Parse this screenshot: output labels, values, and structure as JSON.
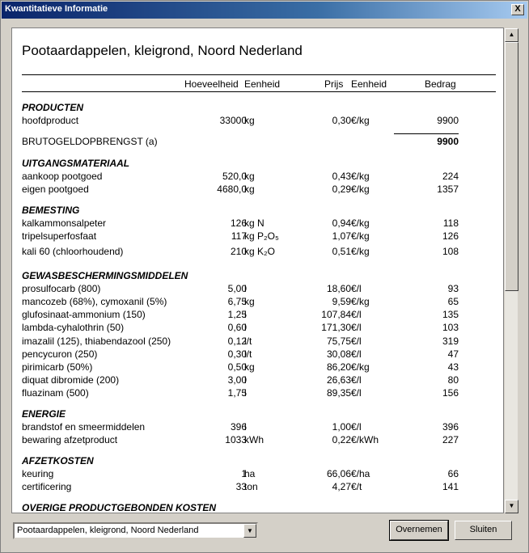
{
  "window": {
    "title": "Kwantitatieve Informatie",
    "close_glyph": "X"
  },
  "report": {
    "title": "Pootaardappelen, kleigrond, Noord Nederland",
    "headers": {
      "qty": "Hoeveelheid",
      "unit": "Eenheid",
      "price": "Prijs",
      "punit": "Eenheid",
      "amount": "Bedrag"
    },
    "sections": {
      "producten": "PRODUCTEN",
      "uitgangsmateriaal": "UITGANGSMATERIAAL",
      "bemesting": "BEMESTING",
      "gewas": "GEWASBESCHERMINGSMIDDELEN",
      "energie": "ENERGIE",
      "afzet": "AFZETKOSTEN",
      "overige": "OVERIGE PRODUCTGEBONDEN KOSTEN"
    },
    "rows": {
      "hoofdproduct": {
        "name": "hoofdproduct",
        "qty": "33000",
        "unit": "kg",
        "price": "0,30",
        "punit": "€/kg",
        "amount": "9900"
      },
      "bruto": {
        "name": "BRUTOGELDOPBRENGST (a)",
        "amount": "9900"
      },
      "aankoop": {
        "name": "aankoop pootgoed",
        "qty": "520,0",
        "unit": "kg",
        "price": "0,43",
        "punit": "€/kg",
        "amount": "224"
      },
      "eigen": {
        "name": "eigen pootgoed",
        "qty": "4680,0",
        "unit": "kg",
        "price": "0,29",
        "punit": "€/kg",
        "amount": "1357"
      },
      "kalkammon": {
        "name": "kalkammonsalpeter",
        "qty": "126",
        "unit": "kg N",
        "price": "0,94",
        "punit": "€/kg",
        "amount": "118"
      },
      "tripel": {
        "name": "tripelsuperfosfaat",
        "qty": "117",
        "unit": "kg P₂O₅",
        "price": "1,07",
        "punit": "€/kg",
        "amount": "126"
      },
      "kali": {
        "name": "kali 60 (chloorhoudend)",
        "qty": "210",
        "unit": "kg K₂O",
        "price": "0,51",
        "punit": "€/kg",
        "amount": "108"
      },
      "prosulfocarb": {
        "name": "prosulfocarb (800)",
        "qty": "5,00",
        "unit": "l",
        "price": "18,60",
        "punit": "€/l",
        "amount": "93"
      },
      "mancozeb": {
        "name": "mancozeb (68%), cymoxanil (5%)",
        "qty": "6,75",
        "unit": "kg",
        "price": "9,59",
        "punit": "€/kg",
        "amount": "65"
      },
      "glufosinaat": {
        "name": "glufosinaat-ammonium (150)",
        "qty": "1,25",
        "unit": "l",
        "price": "107,84",
        "punit": "€/l",
        "amount": "135"
      },
      "lambda": {
        "name": "lambda-cyhalothrin (50)",
        "qty": "0,60",
        "unit": "l",
        "price": "171,30",
        "punit": "€/l",
        "amount": "103"
      },
      "imazalil": {
        "name": "imazalil (125), thiabendazool (250)",
        "qty": "0,12",
        "unit": "l/t",
        "price": "75,75",
        "punit": "€/l",
        "amount": "319"
      },
      "pencycuron": {
        "name": "pencycuron (250)",
        "qty": "0,30",
        "unit": "l/t",
        "price": "30,08",
        "punit": "€/l",
        "amount": "47"
      },
      "pirimicarb": {
        "name": "pirimicarb (50%)",
        "qty": "0,50",
        "unit": "kg",
        "price": "86,20",
        "punit": "€/kg",
        "amount": "43"
      },
      "diquat": {
        "name": "diquat dibromide (200)",
        "qty": "3,00",
        "unit": "l",
        "price": "26,63",
        "punit": "€/l",
        "amount": "80"
      },
      "fluazinam": {
        "name": "fluazinam (500)",
        "qty": "1,75",
        "unit": "l",
        "price": "89,35",
        "punit": "€/l",
        "amount": "156"
      },
      "brandstof": {
        "name": "brandstof en smeermiddelen",
        "qty": "396",
        "unit": "l",
        "price": "1,00",
        "punit": "€/l",
        "amount": "396"
      },
      "bewaring": {
        "name": "bewaring afzetproduct",
        "qty": "1033",
        "unit": "kWh",
        "price": "0,22",
        "punit": "€/kWh",
        "amount": "227"
      },
      "keuring": {
        "name": "keuring",
        "qty": "1",
        "unit": "ha",
        "price": "66,06",
        "punit": "€/ha",
        "amount": "66"
      },
      "certificering": {
        "name": "certificering",
        "qty": "33",
        "unit": "ton",
        "price": "4,27",
        "punit": "€/t",
        "amount": "141"
      }
    }
  },
  "footer": {
    "select_value": "Pootaardappelen, kleigrond, Noord Nederland",
    "overnemen_label": "Overnemen",
    "sluiten_label": "Sluiten"
  }
}
